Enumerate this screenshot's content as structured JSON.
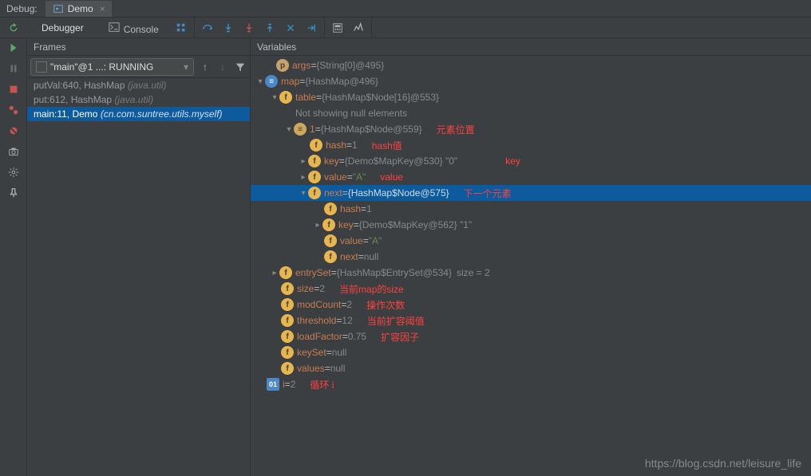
{
  "top": {
    "debugLabel": "Debug:",
    "tabName": "Demo"
  },
  "toolbar": {
    "debuggerTab": "Debugger",
    "consoleTab": "Console"
  },
  "frames": {
    "header": "Frames",
    "thread": "\"main\"@1 ...: RUNNING",
    "items": [
      {
        "fn": "putVal:640, HashMap",
        "pkg": "(java.util)"
      },
      {
        "fn": "put:612, HashMap",
        "pkg": "(java.util)"
      },
      {
        "fn": "main:11, Demo",
        "pkg": "(cn.com.suntree.utils.myself)"
      }
    ]
  },
  "vars": {
    "header": "Variables",
    "args": {
      "name": "args",
      "val": "{String[0]@495}"
    },
    "map": {
      "name": "map",
      "val": "{HashMap@496}"
    },
    "table": {
      "name": "table",
      "val": "{HashMap$Node[16]@553}"
    },
    "notShowing": "Not showing null elements",
    "node1": {
      "name": "1",
      "val": "{HashMap$Node@559}",
      "ann": "元素位置"
    },
    "hash1": {
      "name": "hash",
      "val": "1",
      "ann": "hash值"
    },
    "key1": {
      "name": "key",
      "val": "{Demo$MapKey@530} \"0\"",
      "ann": "key"
    },
    "value1": {
      "name": "value",
      "val": "\"A\"",
      "ann": "value"
    },
    "next1": {
      "name": "next",
      "val": "{HashMap$Node@575}",
      "ann": "下一个元素"
    },
    "hash2": {
      "name": "hash",
      "val": "1"
    },
    "key2": {
      "name": "key",
      "val": "{Demo$MapKey@562} \"1\""
    },
    "value2": {
      "name": "value",
      "val": "\"A\""
    },
    "next2": {
      "name": "next",
      "val": "null"
    },
    "entrySet": {
      "name": "entrySet",
      "val": "{HashMap$EntrySet@534}",
      "extra": "size = 2"
    },
    "size": {
      "name": "size",
      "val": "2",
      "ann": "当前map的size"
    },
    "modCount": {
      "name": "modCount",
      "val": "2",
      "ann": "操作次数"
    },
    "threshold": {
      "name": "threshold",
      "val": "12",
      "ann": "当前扩容阈值"
    },
    "loadFactor": {
      "name": "loadFactor",
      "val": "0.75",
      "ann": "扩容因子"
    },
    "keySet": {
      "name": "keySet",
      "val": "null"
    },
    "values": {
      "name": "values",
      "val": "null"
    },
    "i": {
      "name": "i",
      "val": "2",
      "ann": "循环 i"
    }
  },
  "watermark": "https://blog.csdn.net/leisure_life"
}
